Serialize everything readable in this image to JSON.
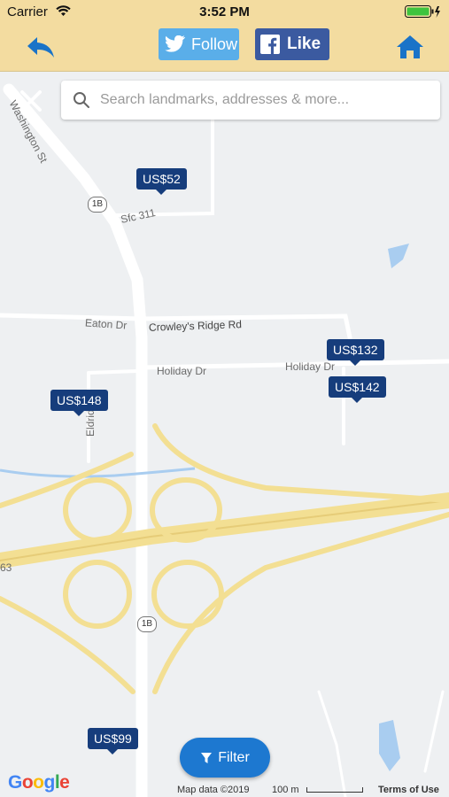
{
  "status": {
    "carrier": "Carrier",
    "time": "3:52 PM"
  },
  "toolbar": {
    "follow_label": "Follow",
    "like_label": "Like"
  },
  "search": {
    "placeholder": "Search landmarks, addresses & more..."
  },
  "map": {
    "street_labels": [
      "Washington St",
      "Sfc 311",
      "Eaton Dr",
      "Crowley's Ridge Rd",
      "Holiday Dr",
      "Holiday Dr",
      "Eldridge",
      "63"
    ],
    "route_shields": [
      "1B",
      "1B"
    ],
    "prices": [
      "US$52",
      "US$132",
      "US$142",
      "US$148",
      "US$99"
    ],
    "filter_label": "Filter",
    "google_logo": "Google",
    "map_data": "Map data ©2019",
    "scale_label": "100 m",
    "terms": "Terms of Use"
  },
  "colors": {
    "toolbar_bg": "#f3dca0",
    "price_bg": "#163d7c",
    "filter_bg": "#1d78d0",
    "twitter": "#5aaee9",
    "facebook": "#3b5aa0"
  }
}
